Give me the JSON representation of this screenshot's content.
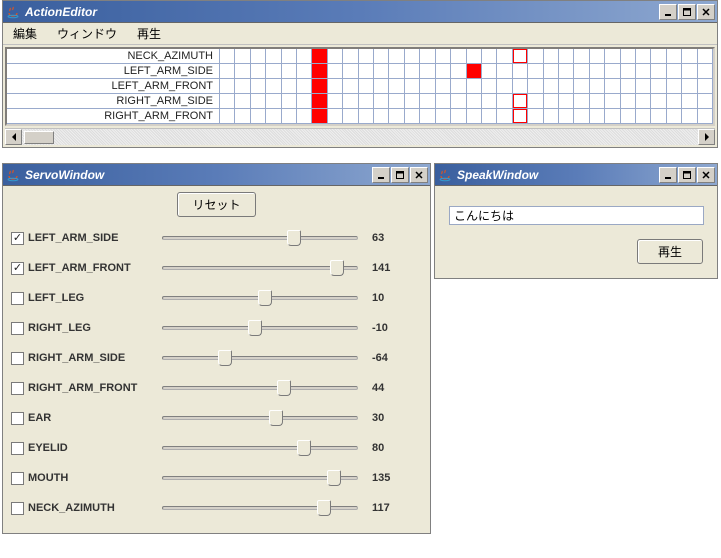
{
  "action_editor": {
    "title": "ActionEditor",
    "menu": {
      "edit": "編集",
      "window": "ウィンドウ",
      "play": "再生"
    },
    "num_cells": 32,
    "rows": [
      {
        "label": "NECK_AZIMUTH",
        "fill": [
          6
        ],
        "outline": [
          19
        ]
      },
      {
        "label": "LEFT_ARM_SIDE",
        "fill": [
          6,
          16
        ],
        "outline": []
      },
      {
        "label": "LEFT_ARM_FRONT",
        "fill": [
          6
        ],
        "outline": []
      },
      {
        "label": "RIGHT_ARM_SIDE",
        "fill": [
          6
        ],
        "outline": [
          19
        ]
      },
      {
        "label": "RIGHT_ARM_FRONT",
        "fill": [
          6
        ],
        "outline": [
          19
        ]
      }
    ]
  },
  "servo_window": {
    "title": "ServoWindow",
    "reset_label": "リセット",
    "slider_min": -180,
    "slider_max": 180,
    "servos": [
      {
        "label": "LEFT_ARM_SIDE",
        "checked": true,
        "value": 63
      },
      {
        "label": "LEFT_ARM_FRONT",
        "checked": true,
        "value": 141
      },
      {
        "label": "LEFT_LEG",
        "checked": false,
        "value": 10
      },
      {
        "label": "RIGHT_LEG",
        "checked": false,
        "value": -10
      },
      {
        "label": "RIGHT_ARM_SIDE",
        "checked": false,
        "value": -64
      },
      {
        "label": "RIGHT_ARM_FRONT",
        "checked": false,
        "value": 44
      },
      {
        "label": "EAR",
        "checked": false,
        "value": 30
      },
      {
        "label": "EYELID",
        "checked": false,
        "value": 80
      },
      {
        "label": "MOUTH",
        "checked": false,
        "value": 135
      },
      {
        "label": "NECK_AZIMUTH",
        "checked": false,
        "value": 117
      }
    ]
  },
  "speak_window": {
    "title": "SpeakWindow",
    "text": "こんにちは",
    "play_label": "再生"
  }
}
